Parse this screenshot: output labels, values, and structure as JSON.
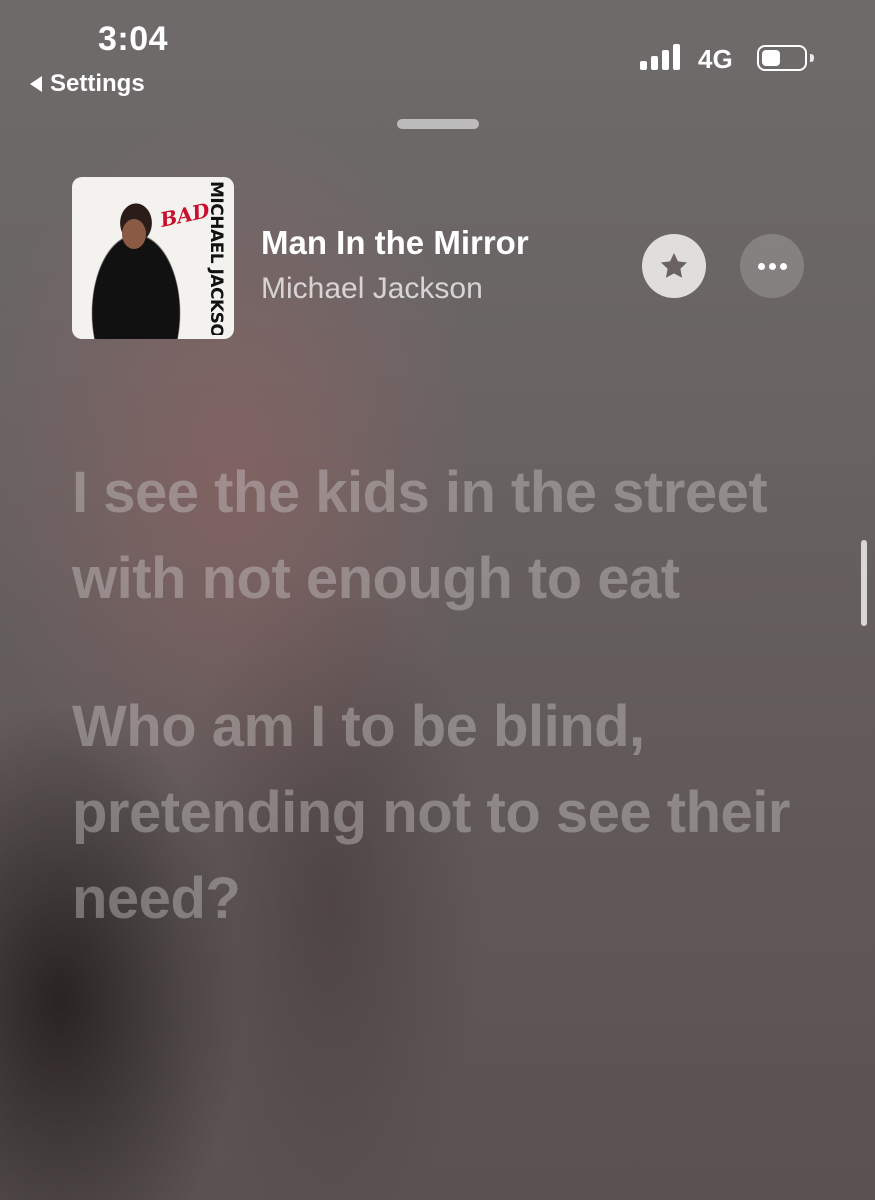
{
  "status_bar": {
    "time": "3:04",
    "back_label": "Settings",
    "network": "4G",
    "battery_level": 0.45
  },
  "now_playing": {
    "title": "Man In the Mirror",
    "artist": "Michael Jackson",
    "artwork": {
      "logo_text": "BAD",
      "side_text": "MICHAEL JACKSON"
    },
    "favorite_icon": "star-icon",
    "more_icon": "ellipsis-icon"
  },
  "lyrics": [
    "I see the kids in the street with not enough to eat",
    "Who am I to be blind, pretending not to see their need?"
  ]
}
